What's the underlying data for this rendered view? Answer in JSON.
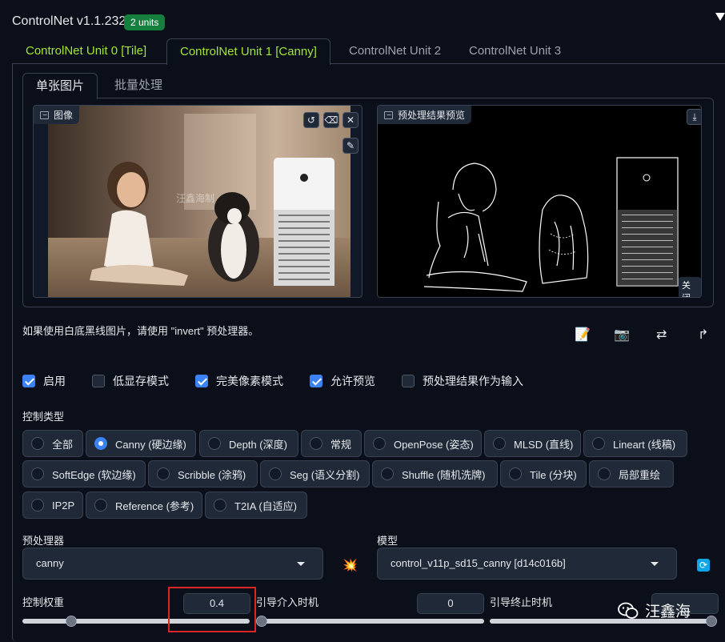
{
  "header": {
    "title": "ControlNet v1.1.232",
    "units_badge": "2 units"
  },
  "unit_tabs": [
    {
      "label": "ControlNet Unit 0 [Tile]"
    },
    {
      "label": "ControlNet Unit 1 [Canny]"
    },
    {
      "label": "ControlNet Unit 2"
    },
    {
      "label": "ControlNet Unit 3"
    }
  ],
  "inner_tabs": [
    {
      "label": "单张图片"
    },
    {
      "label": "批量处理"
    }
  ],
  "image_panel": {
    "label": "图像",
    "watermark": "汪鑫海制"
  },
  "preview_panel": {
    "label": "预处理结果预览",
    "close_label": "关闭"
  },
  "info_text": "如果使用白底黑线图片，请使用 \"invert\" 预处理器。",
  "checkboxes": [
    {
      "label": "启用",
      "checked": true
    },
    {
      "label": "低显存模式",
      "checked": false
    },
    {
      "label": "完美像素模式",
      "checked": true
    },
    {
      "label": "允许预览",
      "checked": true
    },
    {
      "label": "预处理结果作为输入",
      "checked": false
    }
  ],
  "control_type": {
    "label": "控制类型",
    "options": [
      {
        "label": "全部"
      },
      {
        "label": "Canny (硬边缘)"
      },
      {
        "label": "Depth (深度)"
      },
      {
        "label": "常规"
      },
      {
        "label": "OpenPose (姿态)"
      },
      {
        "label": "MLSD (直线)"
      },
      {
        "label": "Lineart (线稿)"
      },
      {
        "label": "SoftEdge (软边缘)"
      },
      {
        "label": "Scribble (涂鸦)"
      },
      {
        "label": "Seg (语义分割)"
      },
      {
        "label": "Shuffle (随机洗牌)"
      },
      {
        "label": "Tile (分块)"
      },
      {
        "label": "局部重绘"
      },
      {
        "label": "IP2P"
      },
      {
        "label": "Reference (参考)"
      },
      {
        "label": "T2IA (自适应)"
      }
    ],
    "selected": "Canny (硬边缘)"
  },
  "preprocessor": {
    "label": "预处理器",
    "value": "canny"
  },
  "model": {
    "label": "模型",
    "value": "control_v11p_sd15_canny [d14c016b]"
  },
  "sliders": {
    "weight": {
      "label": "控制权重",
      "value": "0.4",
      "fraction": 0.2
    },
    "start": {
      "label": "引导介入时机",
      "value": "0",
      "fraction": 0.0
    },
    "end": {
      "label": "引导终止时机",
      "fraction": 1.0
    }
  },
  "watermark_brand": "汪鑫海",
  "colors": {
    "accent": "#3b82f6",
    "badge": "#15803d",
    "tab_green": "#a3e635",
    "highlight": "#dc2626"
  }
}
